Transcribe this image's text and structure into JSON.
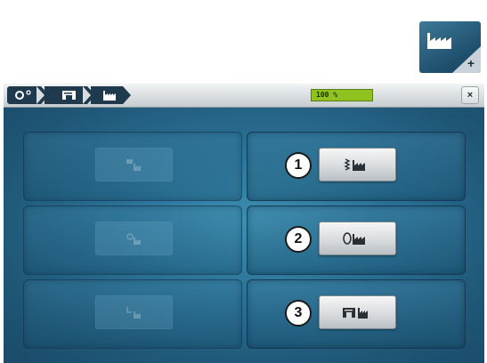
{
  "header_icon": {
    "name": "factory-reset-icon",
    "symbol": "+"
  },
  "titlebar": {
    "breadcrumb": [
      {
        "name": "setup-icon"
      },
      {
        "name": "sewing-machine-icon"
      },
      {
        "name": "factory-icon"
      }
    ],
    "progress_label": "100 %",
    "progress_value": 1.0,
    "close_label": "×"
  },
  "left_column": [
    {
      "icon": "reset-embroidery-icon",
      "enabled": false
    },
    {
      "icon": "reset-all-icon",
      "enabled": false
    },
    {
      "icon": "reset-user-icon",
      "enabled": false
    }
  ],
  "right_column": [
    {
      "number": "1",
      "icon": "stitch-reset-icon"
    },
    {
      "number": "2",
      "icon": "embroidery-reset-icon"
    },
    {
      "number": "3",
      "icon": "machine-reset-icon"
    }
  ],
  "colors": {
    "accent": "#8fc21f",
    "background": "#2a6f93",
    "titlebar": "#1f3a4d"
  }
}
